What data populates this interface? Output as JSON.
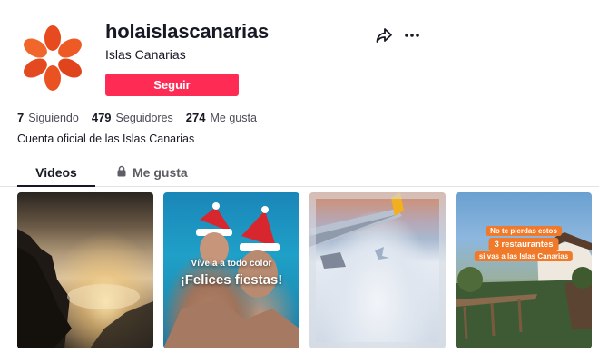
{
  "profile": {
    "username": "holaislascanarias",
    "nickname": "Islas Canarias",
    "follow_label": "Seguir",
    "bio": "Cuenta oficial de las Islas Canarias",
    "logo_color": "#e84a1f"
  },
  "stats": {
    "following": {
      "value": "7",
      "label": "Siguiendo"
    },
    "followers": {
      "value": "479",
      "label": "Seguidores"
    },
    "likes": {
      "value": "274",
      "label": "Me gusta"
    }
  },
  "tabs": {
    "videos": "Videos",
    "liked": "Me gusta",
    "liked_icon": "lock-icon"
  },
  "videos": [
    {
      "scene": "mountain-sunset"
    },
    {
      "scene": "pool-selfie",
      "overlay_small": "Vívela a todo color",
      "overlay_big": "¡Felices fiestas!"
    },
    {
      "scene": "airplane-window-clouds"
    },
    {
      "scene": "restaurant-terrace",
      "tag_1": "No te pierdas estos",
      "tag_2": "3 restaurantes",
      "tag_3": "si vas a las Islas Canarias"
    }
  ],
  "colors": {
    "accent": "#fe2c55",
    "tag_orange": "#f07a2a",
    "text": "#161823"
  },
  "icons": {
    "share": "share-icon",
    "more": "more-icon"
  }
}
